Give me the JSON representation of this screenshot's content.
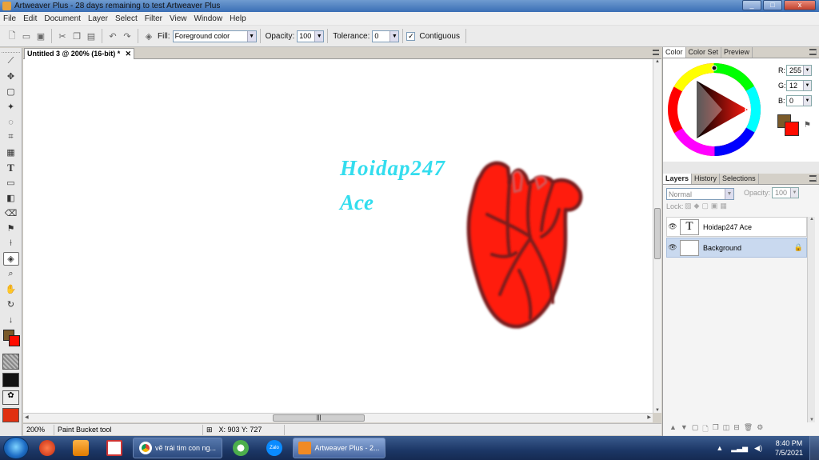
{
  "window": {
    "title": "Artweaver Plus - 28 days remaining to test Artweaver Plus",
    "buttons": [
      "_",
      "□",
      "x"
    ]
  },
  "menu": [
    "File",
    "Edit",
    "Document",
    "Layer",
    "Select",
    "Filter",
    "View",
    "Window",
    "Help"
  ],
  "options": {
    "fill_label": "Fill:",
    "fill_value": "Foreground color",
    "opacity_label": "Opacity:",
    "opacity_value": "100",
    "tolerance_label": "Tolerance:",
    "tolerance_value": "0",
    "contiguous_label": "Contiguous",
    "contiguous_checked": true
  },
  "document": {
    "tab_title": "Untitled 3 @ 200% (16-bit) *",
    "text_line1": "Hoidap247",
    "text_line2": "Ace",
    "text_color": "#33ddee",
    "heart_color": "#ff1a10"
  },
  "status": {
    "zoom": "200%",
    "tool": "Paint Bucket tool",
    "coords": "X: 903  Y: 727"
  },
  "color_panel": {
    "tabs": [
      "Color",
      "Color Set",
      "Preview"
    ],
    "r_label": "R:",
    "r": "255",
    "g_label": "G:",
    "g": "12",
    "b_label": "B:",
    "b": "0",
    "foreground": "#ff0c00",
    "background": "#7a5a2a"
  },
  "layers_panel": {
    "tabs": [
      "Layers",
      "History",
      "Selections"
    ],
    "blend_mode": "Normal",
    "opacity_label": "Opacity:",
    "opacity": "100",
    "lock_label": "Lock:",
    "layers": [
      {
        "name": "Hoidap247 Ace",
        "thumb": "T"
      },
      {
        "name": "Background",
        "thumb": ""
      }
    ]
  },
  "taskbar": {
    "tasks": [
      "vẽ trái tim con ng...",
      "Artweaver Plus - 2..."
    ],
    "time": "8:40 PM",
    "date": "7/5/2021"
  }
}
